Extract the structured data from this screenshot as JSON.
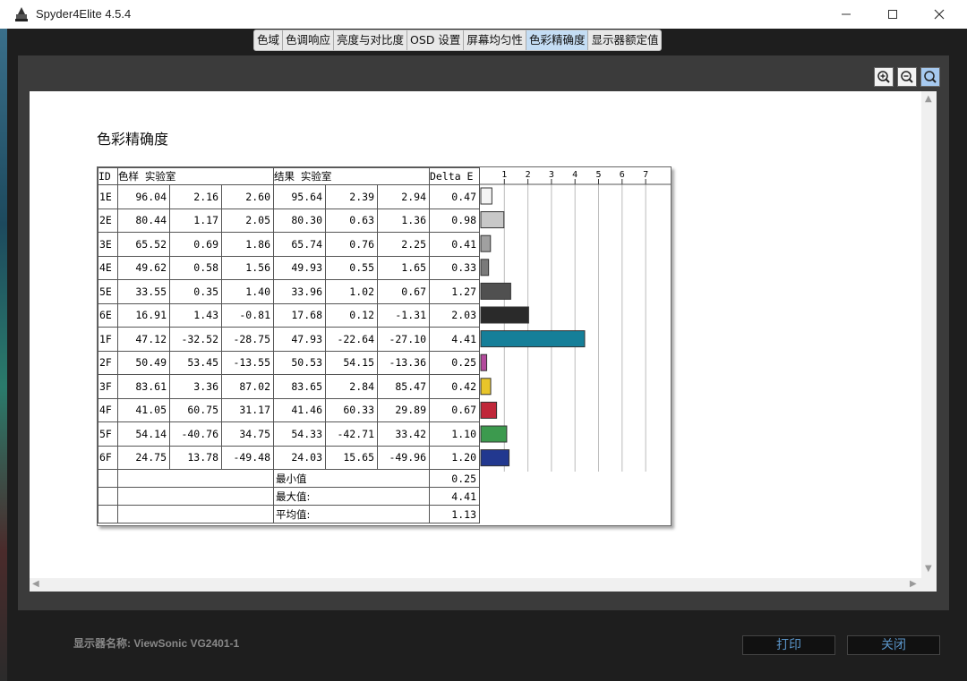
{
  "window": {
    "title": "Spyder4Elite 4.5.4"
  },
  "tabs": [
    {
      "label": "色域"
    },
    {
      "label": "色调响应"
    },
    {
      "label": "亮度与对比度"
    },
    {
      "label": "OSD 设置"
    },
    {
      "label": "屏幕均匀性"
    },
    {
      "label": "色彩精确度",
      "active": true
    },
    {
      "label": "显示器额定值"
    }
  ],
  "report": {
    "title": "色彩精确度",
    "headers": {
      "id": "ID",
      "sample": "色样 实验室",
      "result": "结果 实验室",
      "delta": "Delta E"
    },
    "axis_ticks": [
      "1",
      "2",
      "3",
      "4",
      "5",
      "6",
      "7"
    ],
    "rows": [
      {
        "id": "1E",
        "s": [
          "96.04",
          "2.16",
          "2.60"
        ],
        "r": [
          "95.64",
          "2.39",
          "2.94"
        ],
        "de": "0.47",
        "color": "#f4f4f4"
      },
      {
        "id": "2E",
        "s": [
          "80.44",
          "1.17",
          "2.05"
        ],
        "r": [
          "80.30",
          "0.63",
          "1.36"
        ],
        "de": "0.98",
        "color": "#c8c8c8"
      },
      {
        "id": "3E",
        "s": [
          "65.52",
          "0.69",
          "1.86"
        ],
        "r": [
          "65.74",
          "0.76",
          "2.25"
        ],
        "de": "0.41",
        "color": "#a0a0a0"
      },
      {
        "id": "4E",
        "s": [
          "49.62",
          "0.58",
          "1.56"
        ],
        "r": [
          "49.93",
          "0.55",
          "1.65"
        ],
        "de": "0.33",
        "color": "#7a7a7a"
      },
      {
        "id": "5E",
        "s": [
          "33.55",
          "0.35",
          "1.40"
        ],
        "r": [
          "33.96",
          "1.02",
          "0.67"
        ],
        "de": "1.27",
        "color": "#505050"
      },
      {
        "id": "6E",
        "s": [
          "16.91",
          "1.43",
          "-0.81"
        ],
        "r": [
          "17.68",
          "0.12",
          "-1.31"
        ],
        "de": "2.03",
        "color": "#2a2a2a"
      },
      {
        "id": "1F",
        "s": [
          "47.12",
          "-32.52",
          "-28.75"
        ],
        "r": [
          "47.93",
          "-22.64",
          "-27.10"
        ],
        "de": "4.41",
        "color": "#157f99"
      },
      {
        "id": "2F",
        "s": [
          "50.49",
          "53.45",
          "-13.55"
        ],
        "r": [
          "50.53",
          "54.15",
          "-13.36"
        ],
        "de": "0.25",
        "color": "#b34a9c"
      },
      {
        "id": "3F",
        "s": [
          "83.61",
          "3.36",
          "87.02"
        ],
        "r": [
          "83.65",
          "2.84",
          "85.47"
        ],
        "de": "0.42",
        "color": "#e8c52a"
      },
      {
        "id": "4F",
        "s": [
          "41.05",
          "60.75",
          "31.17"
        ],
        "r": [
          "41.46",
          "60.33",
          "29.89"
        ],
        "de": "0.67",
        "color": "#c0273a"
      },
      {
        "id": "5F",
        "s": [
          "54.14",
          "-40.76",
          "34.75"
        ],
        "r": [
          "54.33",
          "-42.71",
          "33.42"
        ],
        "de": "1.10",
        "color": "#3c9a4e"
      },
      {
        "id": "6F",
        "s": [
          "24.75",
          "13.78",
          "-49.48"
        ],
        "r": [
          "24.03",
          "15.65",
          "-49.96"
        ],
        "de": "1.20",
        "color": "#22388f"
      }
    ],
    "stats": [
      {
        "label": "最小值",
        "value": "0.25"
      },
      {
        "label": "最大值:",
        "value": "4.41"
      },
      {
        "label": "平均值:",
        "value": "1.13"
      }
    ]
  },
  "chart_data": {
    "type": "bar",
    "categories": [
      "1E",
      "2E",
      "3E",
      "4E",
      "5E",
      "6E",
      "1F",
      "2F",
      "3F",
      "4F",
      "5F",
      "6F"
    ],
    "values": [
      0.47,
      0.98,
      0.41,
      0.33,
      1.27,
      2.03,
      4.41,
      0.25,
      0.42,
      0.67,
      1.1,
      1.2
    ],
    "xlabel": "Delta E",
    "xlim": [
      0,
      7.5
    ],
    "grid": true,
    "orientation": "horizontal"
  },
  "footer": {
    "display_name": "显示器名称: ViewSonic VG2401-1",
    "print_label": "打印",
    "close_label": "关闭"
  }
}
